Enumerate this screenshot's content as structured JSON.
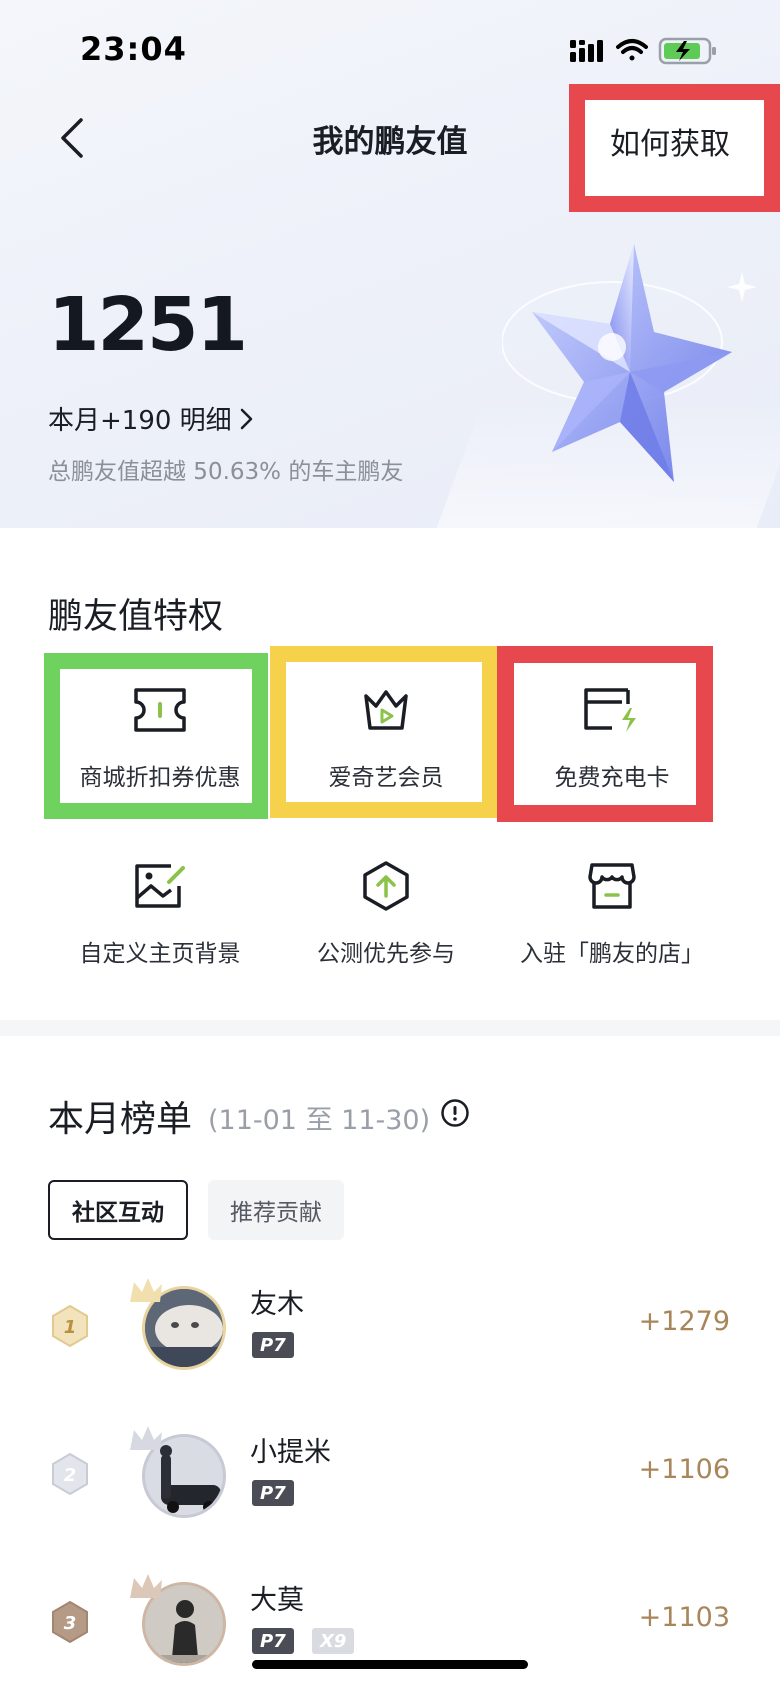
{
  "status": {
    "time": "23:04"
  },
  "nav": {
    "title": "我的鹏友值",
    "how_to_get": "如何获取"
  },
  "summary": {
    "score": "1251",
    "month_change": "本月+190 明细",
    "percent_text": "总鹏友值超越 50.63% 的车主鹏友"
  },
  "privileges": {
    "title": "鹏友值特权",
    "items": [
      {
        "label": "商城折扣券优惠",
        "icon": "coupon-icon"
      },
      {
        "label": "爱奇艺会员",
        "icon": "crown-play-icon"
      },
      {
        "label": "免费充电卡",
        "icon": "charge-card-icon"
      },
      {
        "label": "自定义主页背景",
        "icon": "image-edit-icon"
      },
      {
        "label": "公测优先参与",
        "icon": "upload-hexagon-icon"
      },
      {
        "label": "入驻「鹏友的店」",
        "icon": "store-icon"
      }
    ]
  },
  "ranking": {
    "title": "本月榜单",
    "range": "(11-01 至 11-30)",
    "tabs": [
      "社区互动",
      "推荐贡献"
    ],
    "entries": [
      {
        "rank": "1",
        "name": "友木",
        "badges": [
          "P7"
        ],
        "score": "+1279"
      },
      {
        "rank": "2",
        "name": "小提米",
        "badges": [
          "P7"
        ],
        "score": "+1106"
      },
      {
        "rank": "3",
        "name": "大莫",
        "badges": [
          "P7",
          "X9"
        ],
        "score": "+1103"
      }
    ]
  },
  "colors": {
    "accent_green": "#8bc34a",
    "gold": "#a8865a",
    "highlight_red": "#e6484d",
    "highlight_green": "#6fd25f",
    "highlight_yellow": "#f6d14c"
  }
}
